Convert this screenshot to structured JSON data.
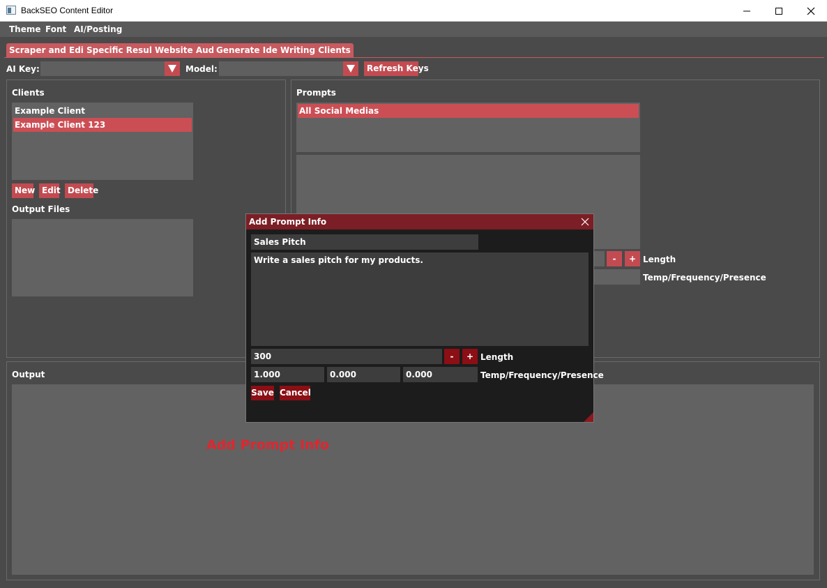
{
  "window": {
    "title": "BackSEO Content Editor"
  },
  "menu": [
    "Theme",
    "Font",
    "AI/Posting"
  ],
  "tabs": [
    "Scraper and Editor",
    "Specific Results",
    "Website Audit",
    "Generate Ideas",
    "Writing Clients"
  ],
  "active_tab": "Writing Clients",
  "toolbar": {
    "ai_key_label": "AI Key:",
    "ai_key_value": "",
    "model_label": "Model:",
    "model_value": "",
    "refresh_label": "Refresh Keys"
  },
  "clients": {
    "title": "Clients",
    "items": [
      "Example Client",
      "Example Client 123"
    ],
    "selected": "Example Client 123",
    "buttons": {
      "new": "New",
      "edit": "Edit",
      "delete": "Delete"
    }
  },
  "output_files": {
    "title": "Output Files"
  },
  "prompts": {
    "title": "Prompts",
    "items": [
      "All Social Medias"
    ],
    "selected": "All Social Medias",
    "minus": "-",
    "plus": "+",
    "length_label": "Length",
    "params_label": "Temp/Frequency/Presence"
  },
  "output": {
    "title": "Output"
  },
  "dialog": {
    "title": "Add Prompt Info",
    "name_value": "Sales Pitch",
    "prompt_text": "Write a sales pitch for my products.",
    "length_value": "300",
    "minus": "-",
    "plus": "+",
    "length_label": "Length",
    "temp_value": "1.000",
    "frequency_value": "0.000",
    "presence_value": "0.000",
    "params_label": "Temp/Frequency/Presence",
    "save": "Save",
    "cancel": "Cancel"
  },
  "overlay_caption": "Add Prompt Info",
  "colors": {
    "accent": "#c75a5f",
    "selection": "#cc4e55",
    "dialog_button": "#8b0f14",
    "dialog_title": "#7c1e25",
    "caption": "#e0262f"
  }
}
